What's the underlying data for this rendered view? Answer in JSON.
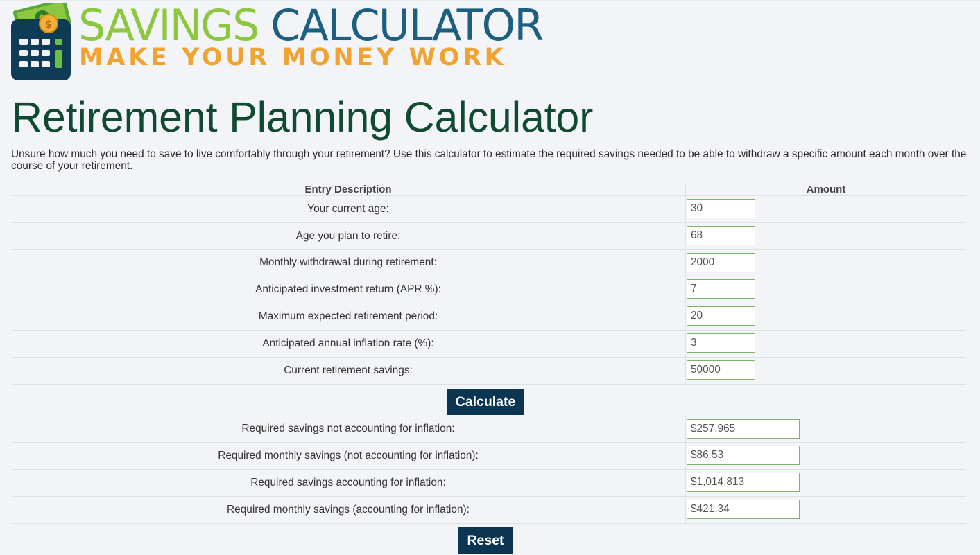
{
  "logo": {
    "title_part1": "SAVINGS",
    "title_part2": "CALCULATOR",
    "tagline": "MAKE YOUR MONEY WORK",
    "colors": {
      "green": "#8dc63f",
      "blue": "#1d5f7e",
      "orange": "#f0a330",
      "navy": "#0c3552"
    }
  },
  "page": {
    "title": "Retirement Planning Calculator",
    "intro": "Unsure how much you need to save to live comfortably through your retirement? Use this calculator to estimate the required savings needed to be able to withdraw a specific amount each month over the course of your retirement."
  },
  "table": {
    "header_desc": "Entry Description",
    "header_amount": "Amount",
    "inputs": [
      {
        "label": "Your current age:",
        "value": "30"
      },
      {
        "label": "Age you plan to retire:",
        "value": "68"
      },
      {
        "label": "Monthly withdrawal during retirement:",
        "value": "2000"
      },
      {
        "label": "Anticipated investment return (APR %):",
        "value": "7"
      },
      {
        "label": "Maximum expected retirement period:",
        "value": "20"
      },
      {
        "label": "Anticipated annual inflation rate (%):",
        "value": "3"
      },
      {
        "label": "Current retirement savings:",
        "value": "50000"
      }
    ],
    "calculate_label": "Calculate",
    "results": [
      {
        "label": "Required savings not accounting for inflation:",
        "value": "$257,965"
      },
      {
        "label": "Required monthly savings (not accounting for inflation):",
        "value": "$86.53"
      },
      {
        "label": "Required savings accounting for inflation:",
        "value": "$1,014,813"
      },
      {
        "label": "Required monthly savings (accounting for inflation):",
        "value": "$421.34"
      }
    ],
    "reset_label": "Reset"
  }
}
